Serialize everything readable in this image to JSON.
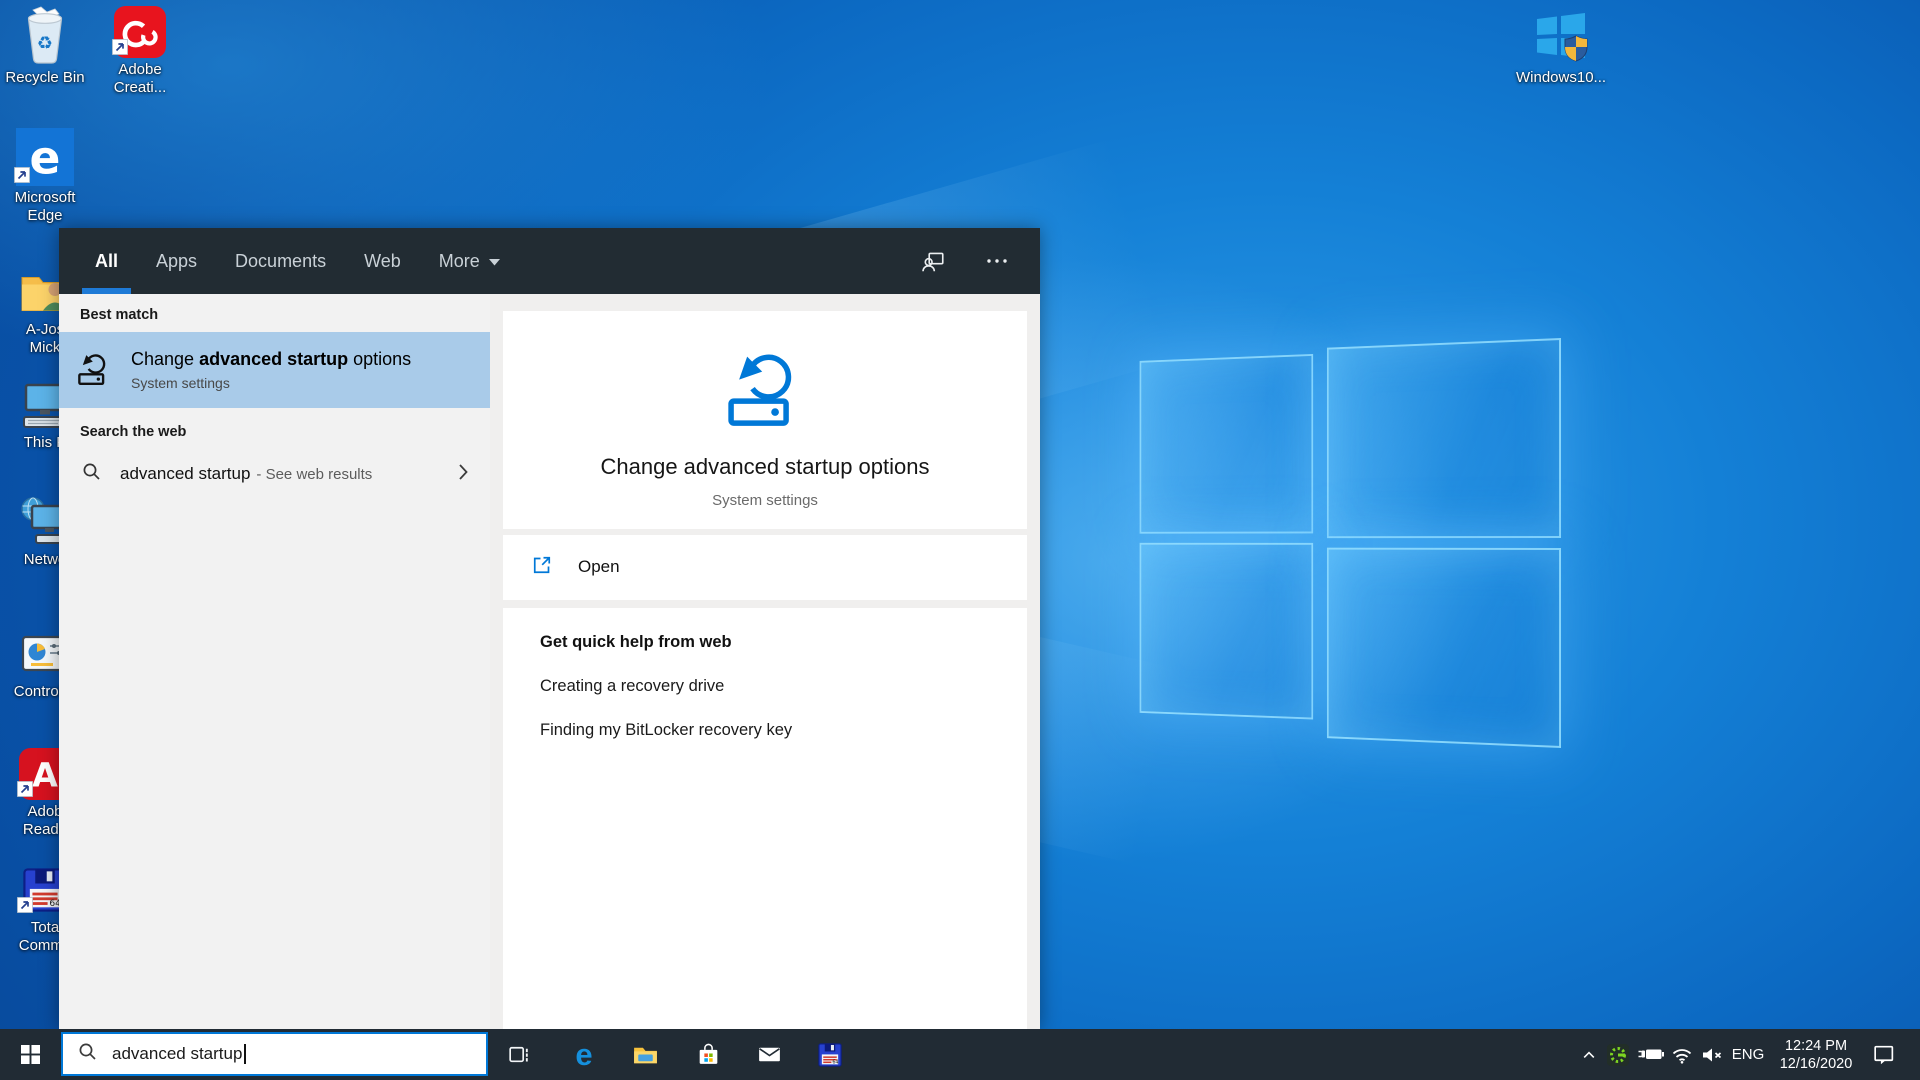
{
  "desktop_icons": [
    {
      "label": "Recycle Bin"
    },
    {
      "lines": [
        "Adobe",
        "Creati..."
      ]
    },
    {
      "lines": [
        "Microsoft",
        "Edge"
      ]
    },
    {
      "lines": [
        "A-Jos",
        "Mick"
      ]
    },
    {
      "label": "This P"
    },
    {
      "label": "Netwo"
    },
    {
      "label": "Control P"
    },
    {
      "lines": [
        "Adob",
        "Reade"
      ]
    },
    {
      "lines": [
        "Tota",
        "Comma"
      ]
    },
    {
      "label": "Windows10..."
    }
  ],
  "search_panel": {
    "tabs": [
      {
        "label": "All"
      },
      {
        "label": "Apps"
      },
      {
        "label": "Documents"
      },
      {
        "label": "Web"
      },
      {
        "label": "More"
      }
    ],
    "best_match_heading": "Best match",
    "best_match": {
      "title_prefix": "Change ",
      "title_bold": "advanced startup",
      "title_suffix": " options",
      "subtitle": "System settings"
    },
    "web_heading": "Search the web",
    "web_item": {
      "query": "advanced startup",
      "hint": "- See web results"
    },
    "detail": {
      "title": "Change advanced startup options",
      "subtitle": "System settings",
      "open_label": "Open",
      "quick_help_heading": "Get quick help from web",
      "links": [
        {
          "label": "Creating a recovery drive"
        },
        {
          "label": "Finding my BitLocker recovery key"
        }
      ]
    },
    "colors": {
      "accent": "#0078d7",
      "highlight": "#a9cbe9",
      "tab_underline": "#1e7ad6",
      "header": "#222c33"
    }
  },
  "taskbar": {
    "search_value": "advanced startup",
    "language": "ENG",
    "clock": {
      "time": "12:24 PM",
      "date": "12/16/2020"
    }
  }
}
